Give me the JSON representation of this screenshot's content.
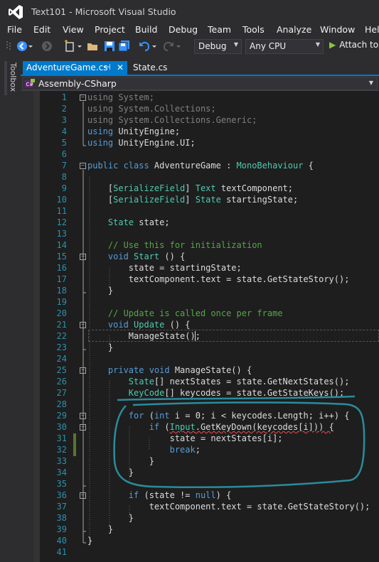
{
  "window": {
    "title": "Text101 - Microsoft Visual Studio"
  },
  "menu": [
    "File",
    "Edit",
    "View",
    "Project",
    "Build",
    "Debug",
    "Team",
    "Tools",
    "Analyze",
    "Window",
    "Hel"
  ],
  "toolbar": {
    "configuration": "Debug",
    "platform": "Any CPU",
    "attach_label": "Attach to"
  },
  "toolbox": {
    "label": "Toolbox"
  },
  "tabs": [
    {
      "label": "AdventureGame.cs",
      "active": true
    },
    {
      "label": "State.cs",
      "active": false
    }
  ],
  "nav": {
    "project": "Assembly-CSharp"
  },
  "colors": {
    "accent": "#007acc",
    "keyword": "#569cd6",
    "type": "#4ec9b0",
    "comment": "#57a64a",
    "line_number": "#2b91af",
    "annotation": "#2a8c9c"
  },
  "code_lines": [
    "1",
    "2",
    "3",
    "4",
    "5",
    "6",
    "7",
    "8",
    "9",
    "10",
    "11",
    "12",
    "13",
    "14",
    "15",
    "16",
    "17",
    "18",
    "19",
    "20",
    "21",
    "22",
    "23",
    "24",
    "25",
    "26",
    "27",
    "28",
    "29",
    "30",
    "31",
    "32",
    "33",
    "34",
    "35",
    "36",
    "37",
    "38",
    "39",
    "40",
    "41"
  ],
  "code": {
    "l1_kw": "using",
    "l1_rest": " System;",
    "l2_kw": "using",
    "l2_rest": " System.Collections;",
    "l3_kw": "using",
    "l3_rest": " System.Collections.Generic;",
    "l4_kw": "using",
    "l4_rest": " UnityEngine;",
    "l5_kw": "using",
    "l5_rest": " UnityEngine.UI;",
    "l7_kw": "public class",
    "l7_name": " AdventureGame : ",
    "l7_base": "MonoBehaviour",
    "l7_end": " {",
    "l9_attr": "SerializeField",
    "l9_type": "Text",
    "l9_rest": " textComponent;",
    "l10_attr": "SerializeField",
    "l10_type": "State",
    "l10_rest": " startingState;",
    "l12_type": "State",
    "l12_rest": " state;",
    "l14_comment": "// Use this for initialization",
    "l15_kw": "void",
    "l15_name": " Start",
    "l15_rest": " () {",
    "l16": "state = startingState;",
    "l17": "textComponent.text = state.GetStateStory();",
    "l18": "}",
    "l20_comment": "// Update is called once per frame",
    "l21_kw": "void",
    "l21_name": " Update",
    "l21_rest": " () {",
    "l22": "ManageState();",
    "l23": "}",
    "l25_kw": "private void",
    "l25_rest": " ManageState() {",
    "l26_type": "State",
    "l26_rest": "[] nextStates = state.GetNextStates();",
    "l27_type": "KeyCode",
    "l27_rest": "[] keycodes = state.GetStateKeys();",
    "l29_kw1": "for",
    "l29_a": " (",
    "l29_kw2": "int",
    "l29_rest": " i = 0; i < keycodes.Length; i++) {",
    "l30_kw": "if",
    "l30_a": " (",
    "l30_type": "Input",
    "l30_rest": ".GetKeyDown(keycodes[i])) {",
    "l31": "state = nextStates[i];",
    "l32_kw": "break",
    "l32_rest": ";",
    "l33": "}",
    "l34": "}",
    "l36_kw": "if",
    "l36_a": " (state != ",
    "l36_null": "null",
    "l36_rest": ") {",
    "l37": "textComponent.text = state.GetStateStory();",
    "l38": "}",
    "l39": "}",
    "l40": "}"
  }
}
